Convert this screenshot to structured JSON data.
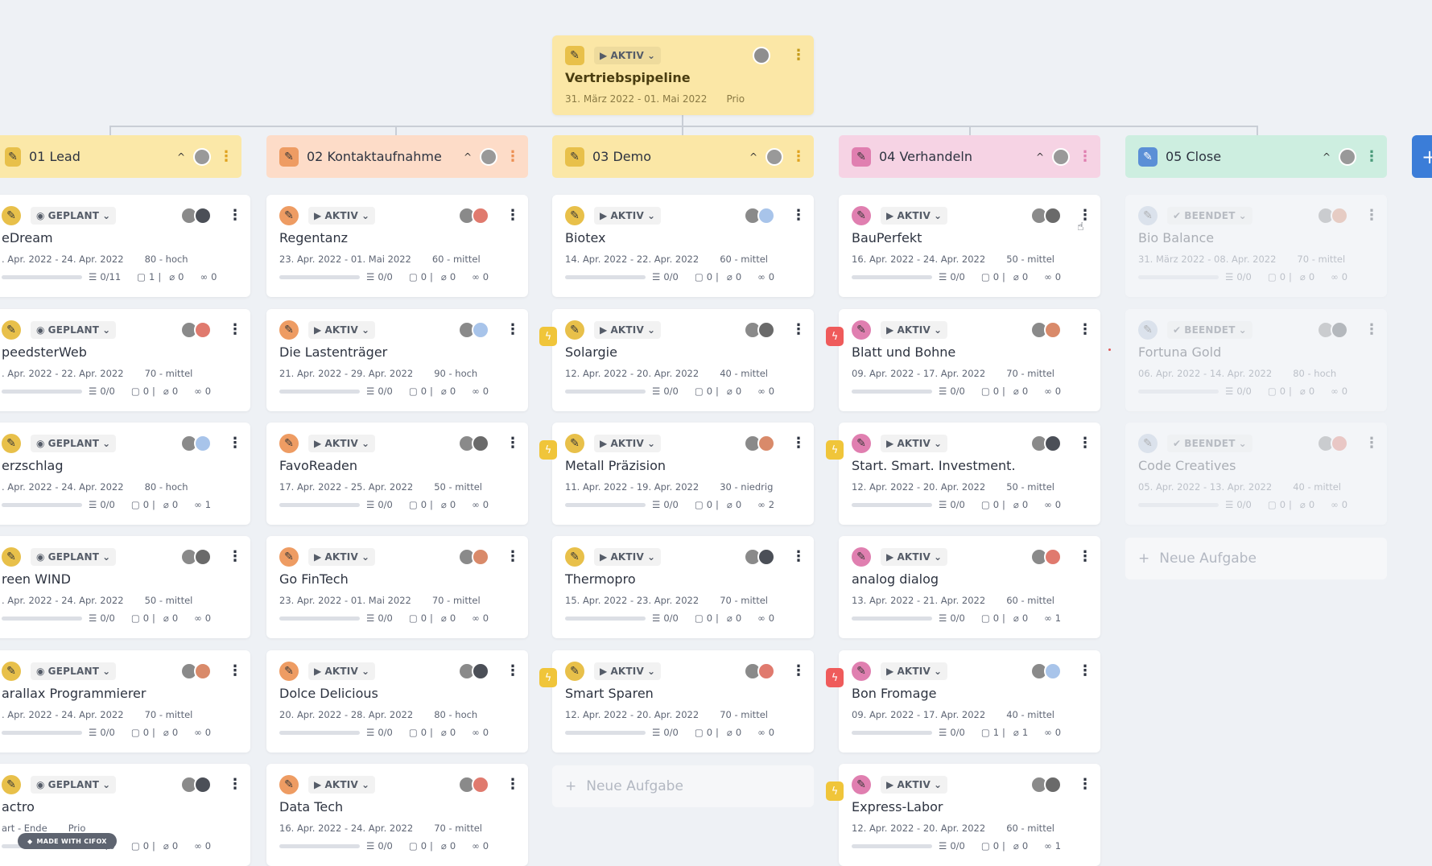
{
  "root": {
    "status": "AKTIV",
    "title": "Vertriebspipeline",
    "dates": "31. März 2022 - 01. Mai 2022",
    "prio": "Prio"
  },
  "colors": {
    "lead": "#fbe8a8",
    "kontakt": "#fddcc8",
    "demo": "#fbe7a6",
    "verhandeln": "#f6d3e4",
    "close": "#cdeee0",
    "accent": "#3b7dd8"
  },
  "columns": [
    {
      "title": "01 Lead",
      "cards": [
        {
          "status": "GEPLANT",
          "title": "eDream",
          "dates": ". Apr. 2022 - 24. Apr. 2022",
          "prio": "80 - hoch",
          "tasks": "0/11",
          "comments": "1",
          "attach": "0",
          "links": "0"
        },
        {
          "status": "GEPLANT",
          "title": "peedsterWeb",
          "dates": ". Apr. 2022 - 22. Apr. 2022",
          "prio": "70 - mittel",
          "tasks": "0/0",
          "comments": "0",
          "attach": "0",
          "links": "0"
        },
        {
          "status": "GEPLANT",
          "title": "erzschlag",
          "dates": ". Apr. 2022 - 24. Apr. 2022",
          "prio": "80 - hoch",
          "tasks": "0/0",
          "comments": "0",
          "attach": "0",
          "links": "1"
        },
        {
          "status": "GEPLANT",
          "title": "reen WIND",
          "dates": ". Apr. 2022 - 24. Apr. 2022",
          "prio": "50 - mittel",
          "tasks": "0/0",
          "comments": "0",
          "attach": "0",
          "links": "0"
        },
        {
          "status": "GEPLANT",
          "title": "arallax Programmierer",
          "dates": ". Apr. 2022 - 24. Apr. 2022",
          "prio": "70 - mittel",
          "tasks": "0/0",
          "comments": "0",
          "attach": "0",
          "links": "0"
        },
        {
          "status": "GEPLANT",
          "title": "actro",
          "dates": "art - Ende",
          "prio": "Prio",
          "tasks": "0/0",
          "comments": "0",
          "attach": "0",
          "links": "0"
        }
      ]
    },
    {
      "title": "02 Kontaktaufnahme",
      "cards": [
        {
          "status": "AKTIV",
          "title": "Regentanz",
          "dates": "23. Apr. 2022 - 01. Mai 2022",
          "prio": "60 - mittel",
          "tasks": "0/0",
          "comments": "0",
          "attach": "0",
          "links": "0"
        },
        {
          "status": "AKTIV",
          "title": "Die Lastenträger",
          "dates": "21. Apr. 2022 - 29. Apr. 2022",
          "prio": "90 - hoch",
          "tasks": "0/0",
          "comments": "0",
          "attach": "0",
          "links": "0"
        },
        {
          "status": "AKTIV",
          "title": "FavoReaden",
          "dates": "17. Apr. 2022 - 25. Apr. 2022",
          "prio": "50 - mittel",
          "tasks": "0/0",
          "comments": "0",
          "attach": "0",
          "links": "0"
        },
        {
          "status": "AKTIV",
          "title": "Go FinTech",
          "dates": "23. Apr. 2022 - 01. Mai 2022",
          "prio": "70 - mittel",
          "tasks": "0/0",
          "comments": "0",
          "attach": "0",
          "links": "0"
        },
        {
          "status": "AKTIV",
          "title": "Dolce Delicious",
          "dates": "20. Apr. 2022 - 28. Apr. 2022",
          "prio": "80 - hoch",
          "tasks": "0/0",
          "comments": "0",
          "attach": "0",
          "links": "0"
        },
        {
          "status": "AKTIV",
          "title": "Data Tech",
          "dates": "16. Apr. 2022 - 24. Apr. 2022",
          "prio": "70 - mittel",
          "tasks": "0/0",
          "comments": "0",
          "attach": "0",
          "links": "0"
        }
      ]
    },
    {
      "title": "03 Demo",
      "cards": [
        {
          "status": "AKTIV",
          "title": "Biotex",
          "dates": "14. Apr. 2022 - 22. Apr. 2022",
          "prio": "60 - mittel",
          "tasks": "0/0",
          "comments": "0",
          "attach": "0",
          "links": "0"
        },
        {
          "status": "AKTIV",
          "title": "Solargie",
          "dates": "12. Apr. 2022 - 20. Apr. 2022",
          "prio": "40 - mittel",
          "tasks": "0/0",
          "comments": "0",
          "attach": "0",
          "links": "0"
        },
        {
          "status": "AKTIV",
          "title": "Metall Präzision",
          "dates": "11. Apr. 2022 - 19. Apr. 2022",
          "prio": "30 - niedrig",
          "tasks": "0/0",
          "comments": "0",
          "attach": "0",
          "links": "2"
        },
        {
          "status": "AKTIV",
          "title": "Thermopro",
          "dates": "15. Apr. 2022 - 23. Apr. 2022",
          "prio": "70 - mittel",
          "tasks": "0/0",
          "comments": "0",
          "attach": "0",
          "links": "0"
        },
        {
          "status": "AKTIV",
          "title": "Smart Sparen",
          "dates": "12. Apr. 2022 - 20. Apr. 2022",
          "prio": "70 - mittel",
          "tasks": "0/0",
          "comments": "0",
          "attach": "0",
          "links": "0"
        }
      ],
      "new_task": "Neue Aufgabe"
    },
    {
      "title": "04 Verhandeln",
      "cards": [
        {
          "status": "AKTIV",
          "title": "BauPerfekt",
          "dates": "16. Apr. 2022 - 24. Apr. 2022",
          "prio": "50 - mittel",
          "tasks": "0/0",
          "comments": "0",
          "attach": "0",
          "links": "0"
        },
        {
          "status": "AKTIV",
          "title": "Blatt und Bohne",
          "dates": "09. Apr. 2022 - 17. Apr. 2022",
          "prio": "70 - mittel",
          "tasks": "0/0",
          "comments": "0",
          "attach": "0",
          "links": "0"
        },
        {
          "status": "AKTIV",
          "title": "Start. Smart. Investment.",
          "dates": "12. Apr. 2022 - 20. Apr. 2022",
          "prio": "50 - mittel",
          "tasks": "0/0",
          "comments": "0",
          "attach": "0",
          "links": "0"
        },
        {
          "status": "AKTIV",
          "title": "analog dialog",
          "dates": "13. Apr. 2022 - 21. Apr. 2022",
          "prio": "60 - mittel",
          "tasks": "0/0",
          "comments": "0",
          "attach": "0",
          "links": "1"
        },
        {
          "status": "AKTIV",
          "title": "Bon Fromage",
          "dates": "09. Apr. 2022 - 17. Apr. 2022",
          "prio": "40 - mittel",
          "tasks": "0/0",
          "comments": "1",
          "attach": "1",
          "links": "0"
        },
        {
          "status": "AKTIV",
          "title": "Express-Labor",
          "dates": "12. Apr. 2022 - 20. Apr. 2022",
          "prio": "60 - mittel",
          "tasks": "0/0",
          "comments": "0",
          "attach": "0",
          "links": "1"
        }
      ]
    },
    {
      "title": "05 Close",
      "cards": [
        {
          "status": "BEENDET",
          "title": "Bio Balance",
          "dates": "31. März 2022 - 08. Apr. 2022",
          "prio": "70 - mittel",
          "tasks": "0/0",
          "comments": "0",
          "attach": "0",
          "links": "0"
        },
        {
          "status": "BEENDET",
          "title": "Fortuna Gold",
          "dates": "06. Apr. 2022 - 14. Apr. 2022",
          "prio": "80 - hoch",
          "tasks": "0/0",
          "comments": "0",
          "attach": "0",
          "links": "0"
        },
        {
          "status": "BEENDET",
          "title": "Code Creatives",
          "dates": "05. Apr. 2022 - 13. Apr. 2022",
          "prio": "40 - mittel",
          "tasks": "0/0",
          "comments": "0",
          "attach": "0",
          "links": "0"
        }
      ],
      "new_task": "Neue Aufgabe"
    }
  ],
  "badge": "MADE WITH CIFOX"
}
